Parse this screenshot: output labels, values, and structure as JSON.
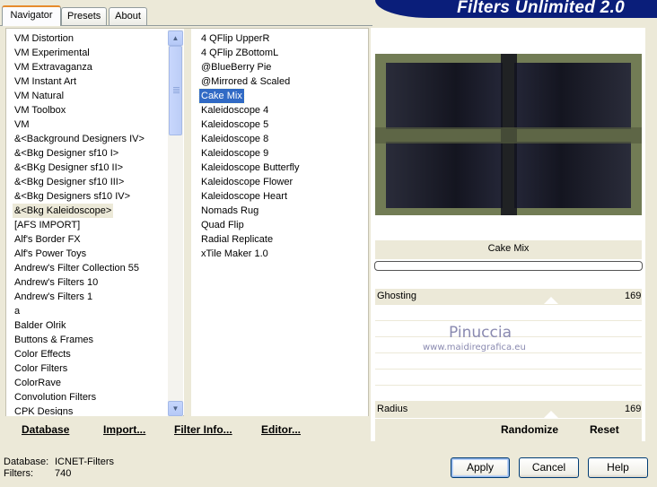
{
  "tabs": [
    "Navigator",
    "Presets",
    "About"
  ],
  "banner_title": "Filters Unlimited 2.0",
  "categories": [
    "VM Distortion",
    "VM Experimental",
    "VM Extravaganza",
    "VM Instant Art",
    "VM Natural",
    "VM Toolbox",
    "VM",
    "&<Background Designers IV>",
    "&<Bkg Designer sf10 I>",
    "&<BKg Designer sf10 II>",
    "&<Bkg Designer sf10 III>",
    "&<Bkg Designers sf10 IV>",
    "&<Bkg Kaleidoscope>",
    "[AFS IMPORT]",
    "Alf's Border FX",
    "Alf's Power Toys",
    "Andrew's Filter Collection 55",
    "Andrew's Filters 10",
    "Andrew's Filters 1",
    "a",
    "Balder Olrik",
    "Buttons & Frames",
    "Color Effects",
    "Color Filters",
    "ColorRave",
    "Convolution Filters",
    "CPK Designs"
  ],
  "selected_category_index": 12,
  "filters": [
    "4 QFlip UpperR",
    "4 QFlip ZBottomL",
    "@BlueBerry Pie",
    "@Mirrored & Scaled",
    "Cake Mix",
    "Kaleidoscope 4",
    "Kaleidoscope 5",
    "Kaleidoscope 8",
    "Kaleidoscope 9",
    "Kaleidoscope Butterfly",
    "Kaleidoscope Flower",
    "Kaleidoscope Heart",
    "Nomads Rug",
    "Quad Flip",
    "Radial Replicate",
    "xTile Maker 1.0"
  ],
  "selected_filter_index": 4,
  "left_buttons": {
    "database": "Database",
    "import": "Import...",
    "filter_info": "Filter Info...",
    "editor": "Editor..."
  },
  "filter_name": "Cake Mix",
  "params": {
    "ghosting_label": "Ghosting",
    "ghosting_value": "169",
    "radius_label": "Radius",
    "radius_value": "169"
  },
  "watermark": {
    "name": "Pinuccia",
    "url": "www.maidiregrafica.eu"
  },
  "right_buttons": {
    "randomize": "Randomize",
    "reset": "Reset"
  },
  "status": {
    "database_label": "Database:",
    "database_value": "ICNET-Filters",
    "filters_label": "Filters:",
    "filters_value": "740"
  },
  "dialog_buttons": {
    "apply": "Apply",
    "cancel": "Cancel",
    "help": "Help"
  },
  "colors": {
    "accent_blue": "#316ac5",
    "banner_blue": "#0a1e7a",
    "preview_olive": "#727c55",
    "watermark": "#8a8ab0"
  }
}
